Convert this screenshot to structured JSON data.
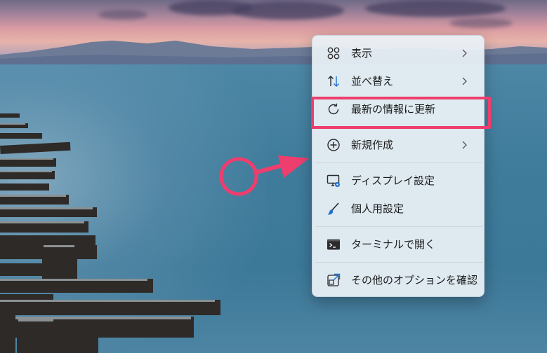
{
  "context_menu": {
    "items": [
      {
        "label": "表示",
        "icon": "grid-icon",
        "has_submenu": true
      },
      {
        "label": "並べ替え",
        "icon": "sort-arrows-icon",
        "has_submenu": true
      },
      {
        "label": "最新の情報に更新",
        "icon": "refresh-icon",
        "has_submenu": false,
        "highlighted": true
      },
      {
        "label": "新規作成",
        "icon": "plus-circle-icon",
        "has_submenu": true
      },
      {
        "label": "ディスプレイ設定",
        "icon": "display-settings-icon",
        "has_submenu": false
      },
      {
        "label": "個人用設定",
        "icon": "brush-icon",
        "has_submenu": false
      },
      {
        "label": "ターミナルで開く",
        "icon": "terminal-icon",
        "has_submenu": false
      },
      {
        "label": "その他のオプションを確認",
        "icon": "external-options-icon",
        "has_submenu": false
      }
    ]
  },
  "annotation": {
    "color": "#ee3e6d",
    "highlighted_item": "最新の情報に更新"
  },
  "wallpaper": {
    "scene": "sea-with-wooden-pier",
    "accent_sky": "#e7b3a9",
    "sea_color": "#3f7b9b"
  }
}
